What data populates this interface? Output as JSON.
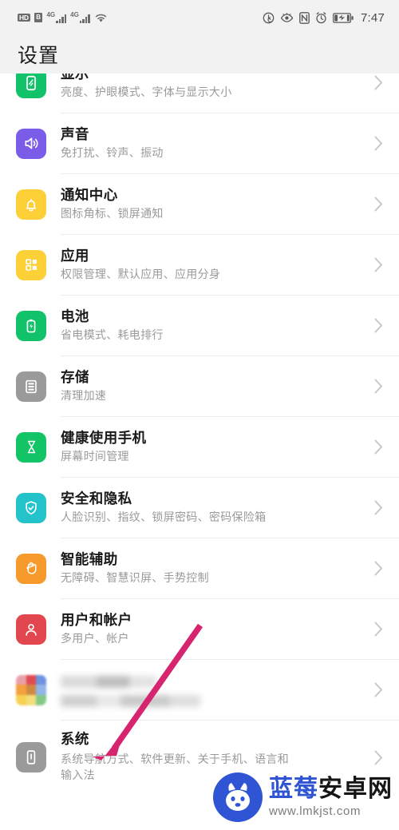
{
  "status_bar": {
    "left_icons": [
      {
        "name": "hd-icon",
        "label": "HD"
      },
      {
        "name": "sim-icon",
        "label": "B"
      },
      {
        "name": "signal-1-icon",
        "label": "4G"
      },
      {
        "name": "signal-2-icon",
        "label": "4G"
      },
      {
        "name": "wifi-icon",
        "label": "wifi"
      }
    ],
    "right_icons": [
      {
        "name": "data-saver-icon",
        "label": "data-saver"
      },
      {
        "name": "eye-comfort-icon",
        "label": "eye-comfort"
      },
      {
        "name": "nfc-icon",
        "label": "NFC"
      },
      {
        "name": "alarm-icon",
        "label": "alarm"
      },
      {
        "name": "battery-icon",
        "label": "battery"
      }
    ],
    "time": "7:47"
  },
  "header": {
    "title": "设置"
  },
  "settings_list": [
    {
      "id": "display",
      "title": "显示",
      "subtitle": "亮度、护眼模式、字体与显示大小",
      "icon": "display-icon",
      "icon_color": "#12c26a"
    },
    {
      "id": "sound",
      "title": "声音",
      "subtitle": "免打扰、铃声、振动",
      "icon": "sound-icon",
      "icon_color": "#7b5ce8"
    },
    {
      "id": "notifications",
      "title": "通知中心",
      "subtitle": "图标角标、锁屏通知",
      "icon": "bell-icon",
      "icon_color": "#fcd036"
    },
    {
      "id": "apps",
      "title": "应用",
      "subtitle": "权限管理、默认应用、应用分身",
      "icon": "apps-grid-icon",
      "icon_color": "#fcd036"
    },
    {
      "id": "battery",
      "title": "电池",
      "subtitle": "省电模式、耗电排行",
      "icon": "battery-icon",
      "icon_color": "#12c26a"
    },
    {
      "id": "storage",
      "title": "存储",
      "subtitle": "清理加速",
      "icon": "storage-icon",
      "icon_color": "#9a9a9a"
    },
    {
      "id": "digital-wellbeing",
      "title": "健康使用手机",
      "subtitle": "屏幕时间管理",
      "icon": "hourglass-icon",
      "icon_color": "#13c466"
    },
    {
      "id": "security-privacy",
      "title": "安全和隐私",
      "subtitle": "人脸识别、指纹、锁屏密码、密码保险箱",
      "icon": "shield-check-icon",
      "icon_color": "#24c3cb"
    },
    {
      "id": "smart-assistance",
      "title": "智能辅助",
      "subtitle": "无障碍、智慧识屏、手势控制",
      "icon": "hand-icon",
      "icon_color": "#f59a2b"
    },
    {
      "id": "users-accounts",
      "title": "用户和帐户",
      "subtitle": "多用户、帐户",
      "icon": "person-icon",
      "icon_color": "#e2474f"
    },
    {
      "id": "google-services",
      "title": "",
      "subtitle": "",
      "icon": "color-grid-icon",
      "icon_color": "#cccccc",
      "blurred": true
    },
    {
      "id": "system",
      "title": "系统",
      "subtitle": "系统导航方式、软件更新、关于手机、语言和\n输入法",
      "icon": "system-phone-icon",
      "icon_color": "#9a9a9a"
    }
  ],
  "annotation": {
    "name": "pink-arrow",
    "color": "#d6246e"
  },
  "watermark": {
    "brand_blue": "蓝莓",
    "brand_black": "安卓网",
    "url": "www.lmkjst.com",
    "logo_color": "#2f55d4"
  }
}
